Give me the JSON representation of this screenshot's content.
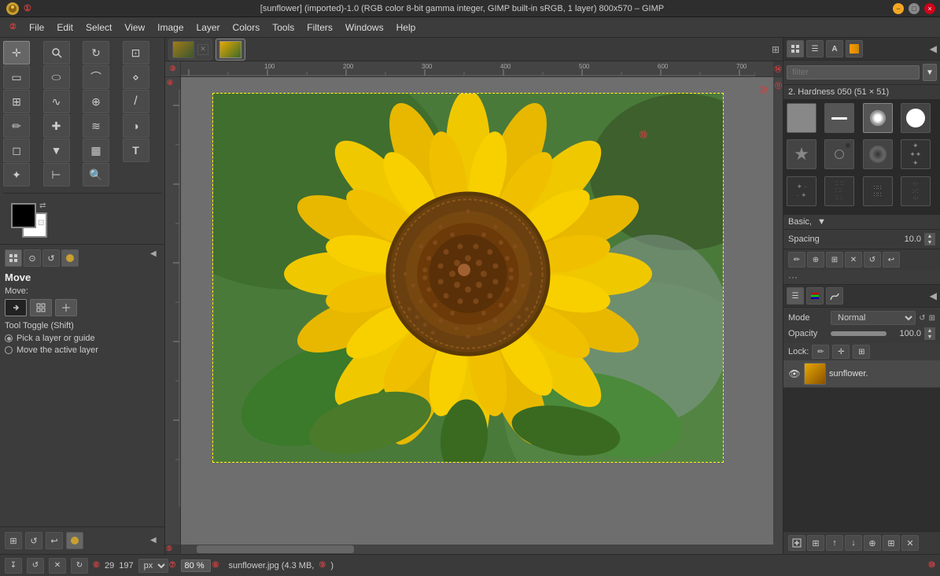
{
  "titlebar": {
    "title": "[sunflower] (imported)-1.0 (RGB color 8-bit gamma integer, GIMP built-in sRGB, 1 layer) 800x570 – GIMP",
    "close": "×",
    "minimize": "−",
    "maximize": "□"
  },
  "menubar": {
    "items": [
      "File",
      "Edit",
      "Select",
      "View",
      "Image",
      "Layer",
      "Colors",
      "Tools",
      "Filters",
      "Windows",
      "Help"
    ]
  },
  "toolbar": {
    "tools": [
      {
        "name": "move-tool",
        "icon": "✛",
        "active": true
      },
      {
        "name": "zoom-tool",
        "icon": "🔍"
      },
      {
        "name": "rotate-tool",
        "icon": "↻"
      },
      {
        "name": "crop-tool",
        "icon": "⊡"
      },
      {
        "name": "select-rect",
        "icon": "▭"
      },
      {
        "name": "select-ellipse",
        "icon": "⬭"
      },
      {
        "name": "select-free",
        "icon": "⌒"
      },
      {
        "name": "select-fuzzy",
        "icon": "⋈"
      },
      {
        "name": "transform-tool",
        "icon": "⟆"
      },
      {
        "name": "warp-tool",
        "icon": "∿"
      },
      {
        "name": "clone-tool",
        "icon": "⊕"
      },
      {
        "name": "pencil-tool",
        "icon": "/"
      },
      {
        "name": "paint-tool",
        "icon": "✏"
      },
      {
        "name": "heal-tool",
        "icon": "✚"
      },
      {
        "name": "smudge-tool",
        "icon": "≋"
      },
      {
        "name": "dodge-burn",
        "icon": "◑"
      },
      {
        "name": "erase-tool",
        "icon": "◻"
      },
      {
        "name": "bucket-fill",
        "icon": "▼"
      },
      {
        "name": "blend-tool",
        "icon": "▦"
      },
      {
        "name": "text-tool",
        "icon": "T"
      },
      {
        "name": "eyedropper",
        "icon": "✦"
      },
      {
        "name": "measure-tool",
        "icon": "⊢"
      },
      {
        "name": "search-tool",
        "icon": "⊙"
      }
    ]
  },
  "tool_options": {
    "name": "Move",
    "move_label": "Move:",
    "toggle_label": "Tool Toggle  (Shift)",
    "options": [
      {
        "label": "Pick a layer or guide"
      },
      {
        "label": "Move the active layer"
      }
    ]
  },
  "image_tabs": [
    {
      "name": "sunflower-thumb1",
      "active": false
    },
    {
      "name": "sunflower-thumb2",
      "active": true
    }
  ],
  "statusbar": {
    "coords_x": "29",
    "coords_y": "197",
    "units": "px",
    "zoom": "80 %",
    "filename": "sunflower.jpg (4.3 MB,",
    "extra": ")"
  },
  "right_panel": {
    "filter_placeholder": "filter",
    "brush_name": "2. Hardness 050 (51 × 51)",
    "brush_preset_label": "Basic,",
    "spacing_label": "Spacing",
    "spacing_value": "10.0",
    "layers": {
      "mode_label": "Mode",
      "mode_value": "Normal",
      "opacity_label": "Opacity",
      "opacity_value": "100.0",
      "lock_label": "Lock:",
      "layer_name": "sunflower."
    },
    "action_buttons": [
      "⊕",
      "⊙",
      "↧",
      "✕",
      "↺",
      "↩",
      "⊞"
    ]
  }
}
